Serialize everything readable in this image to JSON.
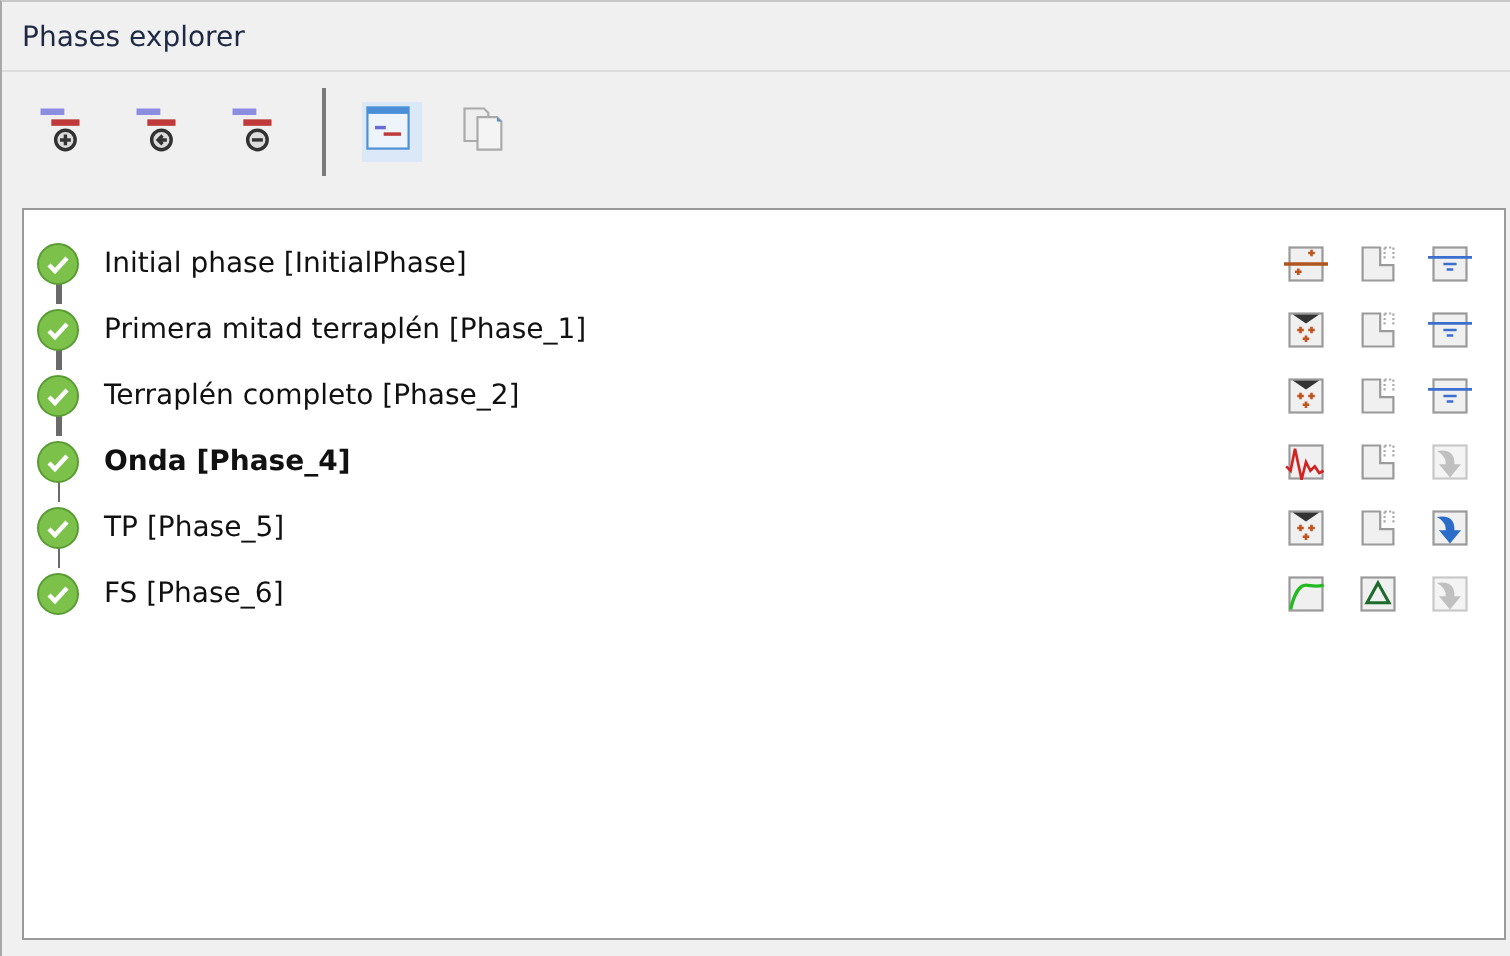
{
  "panel": {
    "title": "Phases explorer"
  },
  "toolbar": [
    {
      "kind": "add-phase",
      "pressed": false
    },
    {
      "kind": "insert-phase",
      "pressed": false
    },
    {
      "kind": "delete-phase",
      "pressed": false
    },
    {
      "kind": "separator"
    },
    {
      "kind": "phases-window",
      "pressed": true
    },
    {
      "kind": "copy",
      "pressed": false
    }
  ],
  "phases": [
    {
      "label": "Initial phase [InitialPhase]",
      "selected": false,
      "icons": [
        {
          "kind": "k0"
        },
        {
          "kind": "staged"
        },
        {
          "kind": "phreatic"
        }
      ]
    },
    {
      "label": "Primera mitad terraplén [Phase_1]",
      "selected": false,
      "connector": {
        "kind": "thick"
      },
      "icons": [
        {
          "kind": "plastic"
        },
        {
          "kind": "staged"
        },
        {
          "kind": "phreatic"
        }
      ]
    },
    {
      "label": "Terraplén completo [Phase_2]",
      "selected": false,
      "connector": {
        "kind": "thick"
      },
      "icons": [
        {
          "kind": "plastic"
        },
        {
          "kind": "staged"
        },
        {
          "kind": "phreatic"
        }
      ]
    },
    {
      "label": "Onda [Phase_4]",
      "selected": true,
      "connector": {
        "kind": "thick"
      },
      "icons": [
        {
          "kind": "dynamic"
        },
        {
          "kind": "staged"
        },
        {
          "kind": "previous-off"
        }
      ]
    },
    {
      "label": "TP [Phase_5]",
      "selected": false,
      "connector": {
        "kind": "thin"
      },
      "icons": [
        {
          "kind": "plastic"
        },
        {
          "kind": "staged"
        },
        {
          "kind": "previous-on"
        }
      ]
    },
    {
      "label": "FS [Phase_6]",
      "selected": false,
      "connector": {
        "kind": "thin"
      },
      "icons": [
        {
          "kind": "safety"
        },
        {
          "kind": "incremental"
        },
        {
          "kind": "previous-off"
        }
      ]
    }
  ]
}
